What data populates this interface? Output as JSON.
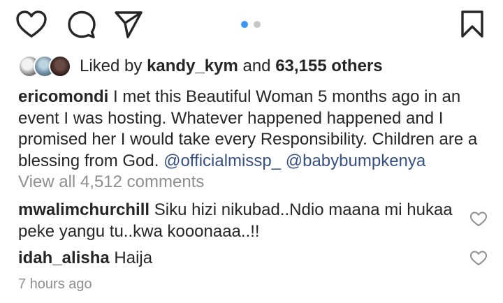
{
  "actions": {
    "like_icon": "heart-outline",
    "comment_icon": "speech-bubble",
    "share_icon": "paper-plane",
    "save_icon": "bookmark-outline"
  },
  "carousel": {
    "total": 2,
    "active_index": 0,
    "active_color": "#3897f0",
    "inactive_color": "#c7c7c7"
  },
  "likes": {
    "prefix": "Liked by",
    "user": "kandy_kym",
    "conjunction": "and",
    "others": "63,155 others"
  },
  "caption": {
    "username": "ericomondi",
    "text": "I met this Beautiful Woman  5 months ago in an event I was hosting. Whatever happened happened and I promised her I would take every Responsibility. Children are a blessing from God.",
    "mention_1": "@officialmissp_",
    "mention_2": "@babybumpkenya"
  },
  "view_all_comments": "View all 4,512 comments",
  "comments": [
    {
      "username": "mwalimchurchill",
      "text": "Siku hizi nikubad..Ndio maana mi hukaa peke yangu tu..kwa kooonaaa..!!"
    },
    {
      "username": "idah_alisha",
      "text": "Haija"
    }
  ],
  "timestamp": "7 hours ago",
  "colors": {
    "text": "#262626",
    "mention": "#385185",
    "muted": "#8e8e8e"
  }
}
